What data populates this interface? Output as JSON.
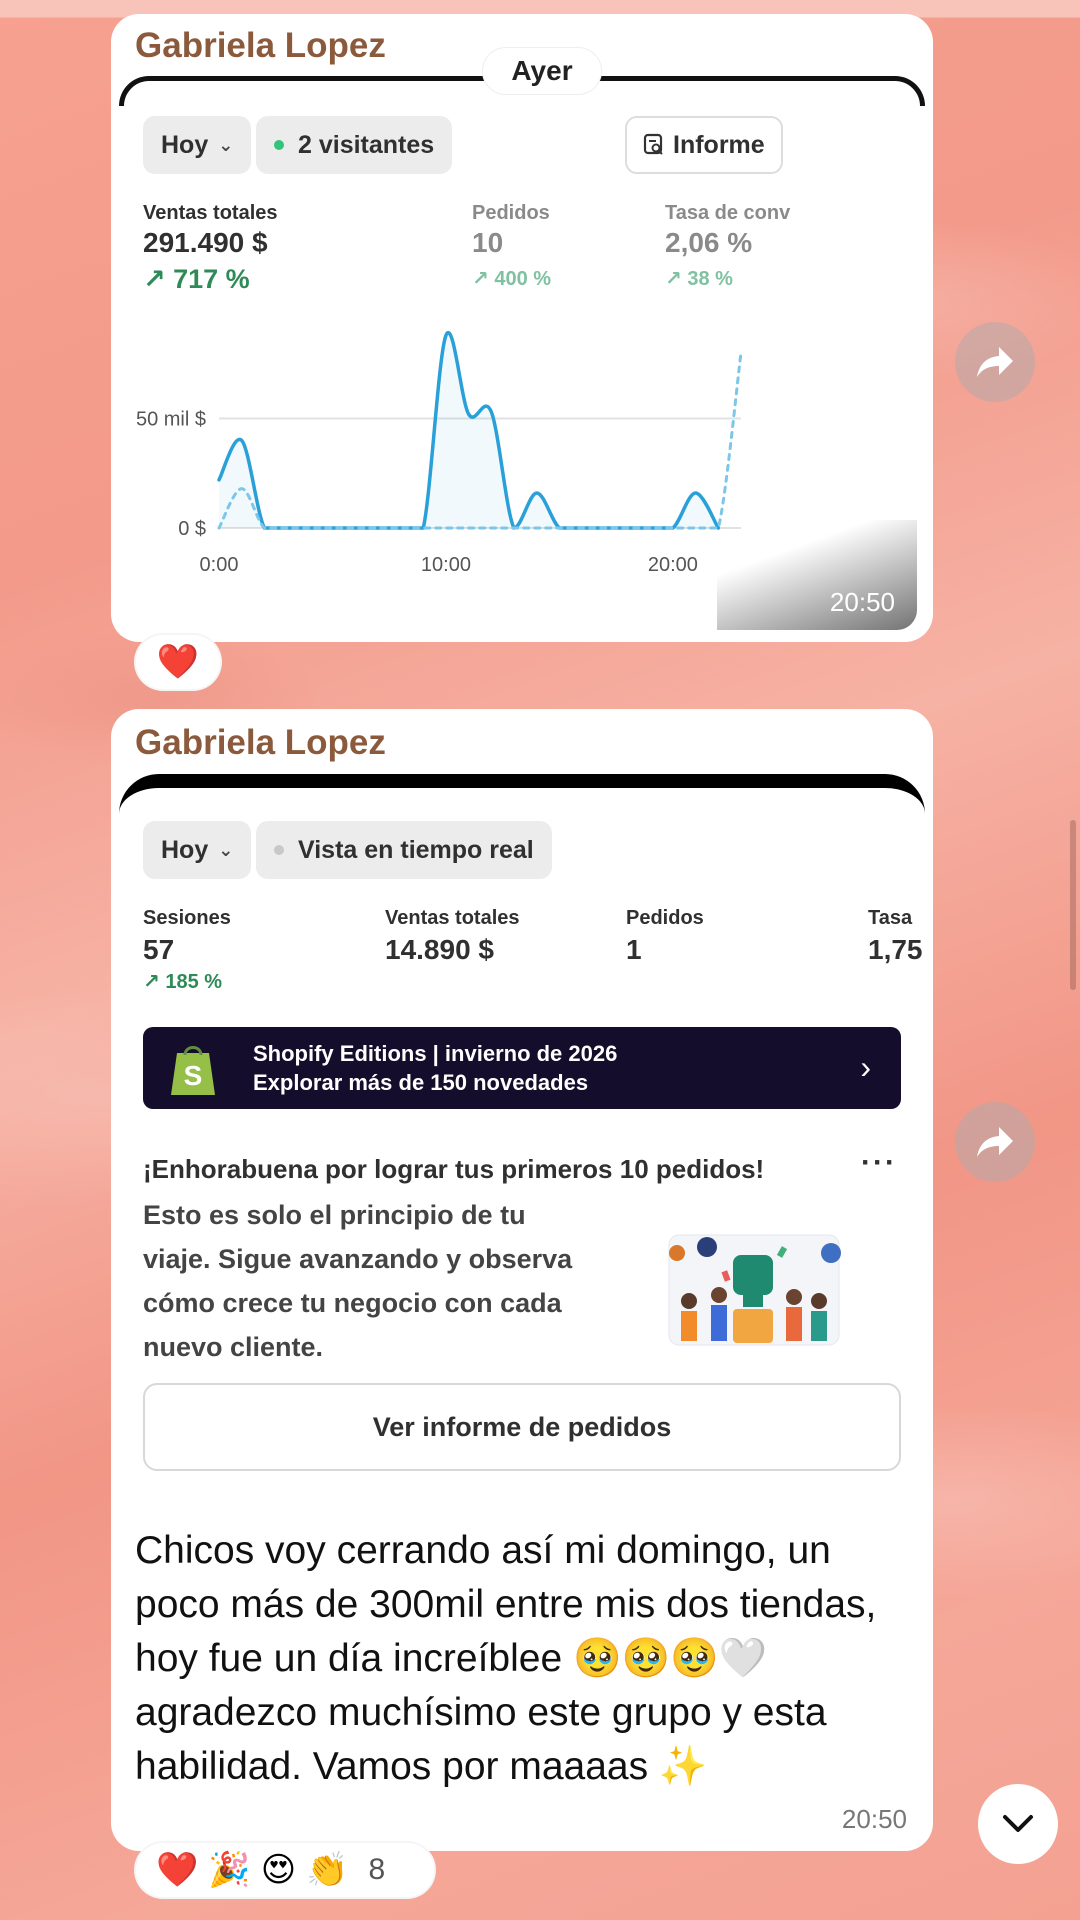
{
  "chat": {
    "date_separator": "Ayer"
  },
  "message1": {
    "sender": "Gabriela Lopez",
    "time": "20:50",
    "reaction": "❤️",
    "screenshot": {
      "period_filter": "Hoy",
      "visitors_label": "2 visitantes",
      "report_button": "Informe",
      "metrics": [
        {
          "label": "Ventas totales",
          "value": "291.490 $",
          "change": "717 %"
        },
        {
          "label": "Pedidos",
          "value": "10",
          "change": "400 %"
        },
        {
          "label": "Tasa de conv",
          "value": "2,06 %",
          "change": "38 %"
        }
      ],
      "chart_data": {
        "type": "line",
        "title": "",
        "xlabel": "",
        "ylabel": "",
        "x_ticks": [
          "0:00",
          "10:00",
          "20:00"
        ],
        "y_ticks": [
          "0 $",
          "50 mil $"
        ],
        "ylim": [
          0,
          90000
        ],
        "x": [
          0,
          1,
          2,
          3,
          4,
          5,
          6,
          7,
          8,
          9,
          10,
          11,
          12,
          13,
          14,
          15,
          16,
          17,
          18,
          19,
          20,
          21,
          22,
          23
        ],
        "series": [
          {
            "name": "",
            "style": "solid",
            "color": "#29a0d8",
            "values": [
              22000,
              40000,
              0,
              0,
              0,
              0,
              0,
              0,
              0,
              0,
              88000,
              52000,
              53000,
              0,
              16000,
              0,
              0,
              0,
              0,
              0,
              0,
              16000,
              0,
              null
            ]
          },
          {
            "name": "",
            "style": "dashed",
            "color": "#7cc6e8",
            "values": [
              0,
              18000,
              0,
              0,
              0,
              0,
              0,
              0,
              0,
              0,
              0,
              0,
              0,
              0,
              0,
              0,
              0,
              0,
              0,
              0,
              0,
              0,
              0,
              80000
            ]
          }
        ]
      }
    }
  },
  "message2": {
    "sender": "Gabriela Lopez",
    "time": "20:50",
    "screenshot": {
      "period_filter": "Hoy",
      "realtime_label": "Vista en tiempo real",
      "metrics": [
        {
          "label": "Sesiones",
          "value": "57",
          "change": "185 %"
        },
        {
          "label": "Ventas totales",
          "value": "14.890 $",
          "change": ""
        },
        {
          "label": "Pedidos",
          "value": "1",
          "change": ""
        },
        {
          "label": "Tasa",
          "value": "1,75",
          "change": ""
        }
      ],
      "banner": {
        "line1": "Shopify Editions | invierno de 2026",
        "line2": "Explorar más de 150 novedades"
      },
      "congrats": {
        "title": "¡Enhorabuena por lograr tus primeros 10 pedidos!",
        "body": "Esto es solo el principio de tu viaje. Sigue avanzando y observa cómo crece tu negocio con cada nuevo cliente.",
        "button": "Ver informe de pedidos"
      }
    },
    "text": "Chicos voy cerrando así mi domingo, un poco más de 300mil entre mis dos tiendas, hoy fue un día increíblee 🥹🥹🥹🤍 agradezco muchísimo este grupo y esta habilidad. Vamos por maaaas ✨",
    "reactions": [
      "❤️",
      "🎉",
      "😍",
      "👏"
    ],
    "reaction_count": "8"
  },
  "colors": {
    "chart_line": "#29a0d8",
    "positive": "#2e8b57",
    "banner_bg": "#140d2b",
    "sender_name": "#8b5a3c"
  }
}
